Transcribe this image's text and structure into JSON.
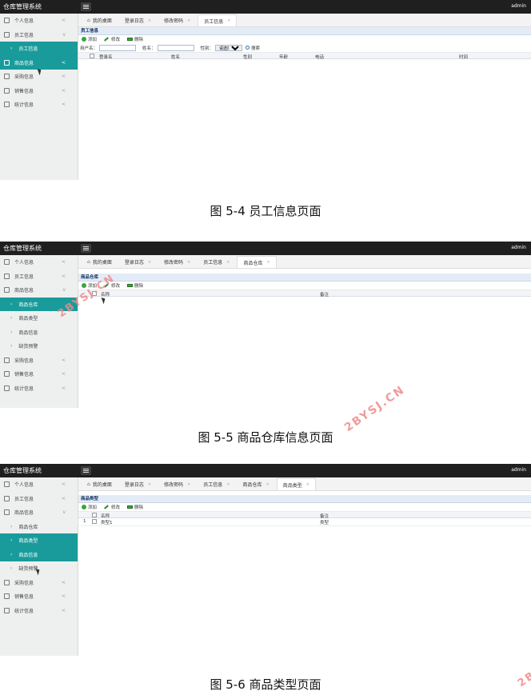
{
  "app_title": "仓库管理系统",
  "user": "admin",
  "screens": [
    {
      "sidebar": [
        {
          "label": "个人信息",
          "chev": "<"
        },
        {
          "label": "员工信息",
          "chev": "v"
        },
        {
          "label": "员工信息",
          "sub": true,
          "active": true
        },
        {
          "label": "商品信息",
          "chev": "<",
          "active": true
        },
        {
          "label": "采购信息",
          "chev": "<"
        },
        {
          "label": "销售信息",
          "chev": "<"
        },
        {
          "label": "统计信息",
          "chev": "<"
        }
      ],
      "tabs": [
        "我的桌面",
        "登录日志",
        "修改密码",
        "员工信息"
      ],
      "panel_title": "员工信息",
      "toolbar": {
        "add": "添加",
        "edit": "修改",
        "delete": "删除"
      },
      "search": {
        "username_label": "用户名：",
        "name_label": "姓名：",
        "gender_label": "性别：",
        "gender_select": "请选择...",
        "search_btn": "搜索"
      },
      "columns": [
        "登录名",
        "姓名",
        "性别",
        "年龄",
        "电话",
        "时间"
      ]
    },
    {
      "sidebar": [
        {
          "label": "个人信息",
          "chev": "<"
        },
        {
          "label": "员工信息",
          "chev": "<"
        },
        {
          "label": "商品信息",
          "chev": "v"
        },
        {
          "label": "商品仓库",
          "sub": true,
          "active": true
        },
        {
          "label": "商品类型",
          "sub": true
        },
        {
          "label": "商品信息",
          "sub": true
        },
        {
          "label": "缺货预警",
          "sub": true
        },
        {
          "label": "采购信息",
          "chev": "<"
        },
        {
          "label": "销售信息",
          "chev": "<"
        },
        {
          "label": "统计信息",
          "chev": "<"
        }
      ],
      "tabs": [
        "我的桌面",
        "登录日志",
        "修改密码",
        "员工信息",
        "商品仓库"
      ],
      "panel_title": "商品仓库",
      "toolbar": {
        "add": "添加",
        "edit": "修改",
        "delete": "删除"
      },
      "columns": [
        "名称",
        "备注"
      ]
    },
    {
      "sidebar": [
        {
          "label": "个人信息",
          "chev": "<"
        },
        {
          "label": "员工信息",
          "chev": "<"
        },
        {
          "label": "商品信息",
          "chev": "v"
        },
        {
          "label": "商品仓库",
          "sub": true
        },
        {
          "label": "商品类型",
          "sub": true,
          "active": true
        },
        {
          "label": "商品信息",
          "sub": true,
          "active": true
        },
        {
          "label": "缺货预警",
          "sub": true
        },
        {
          "label": "采购信息",
          "chev": "<"
        },
        {
          "label": "销售信息",
          "chev": "<"
        },
        {
          "label": "统计信息",
          "chev": "<"
        }
      ],
      "tabs": [
        "我的桌面",
        "登录日志",
        "修改密码",
        "员工信息",
        "商品仓库",
        "商品类型"
      ],
      "panel_title": "商品类型",
      "toolbar": {
        "add": "添加",
        "edit": "修改",
        "delete": "删除"
      },
      "columns": [
        "名称",
        "备注"
      ],
      "rows": [
        {
          "num": "1",
          "name": "类型1",
          "note": "类型"
        }
      ]
    }
  ],
  "captions": [
    "图 5-4 员工信息页面",
    "图 5-5 商品仓库信息页面",
    "图 5-6 商品类型页面"
  ],
  "watermarks": [
    "2BYSJ.CN",
    "2BYSJ.CN",
    "2B"
  ]
}
